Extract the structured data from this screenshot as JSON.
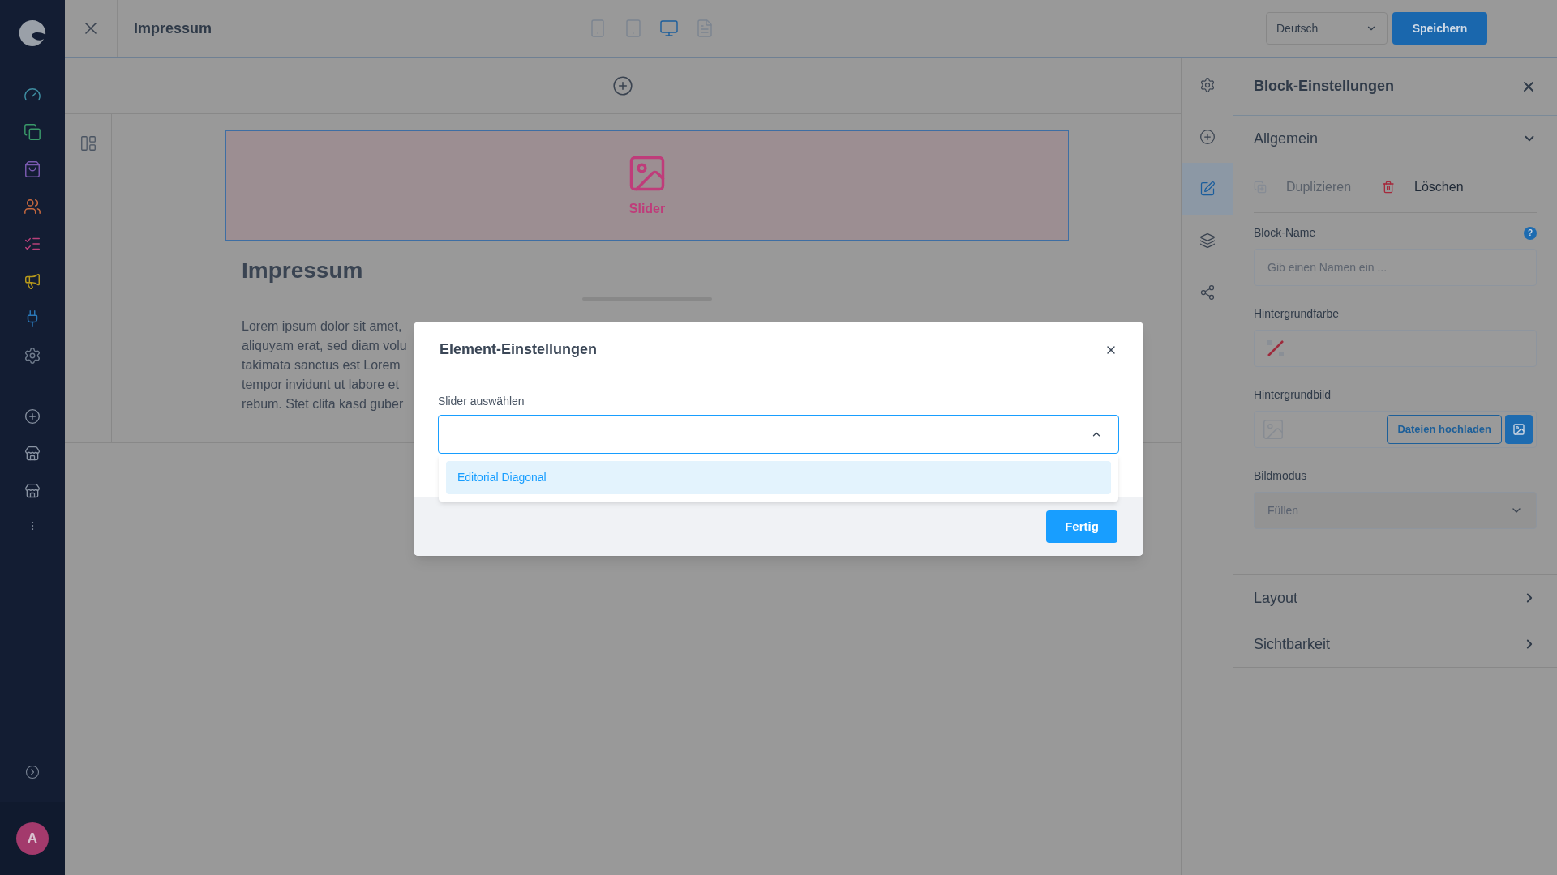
{
  "sidebar": {
    "items": [
      {
        "kind": "gauge",
        "color": "#3f8fa3"
      },
      {
        "kind": "copy",
        "color": "#3a9a6a"
      },
      {
        "kind": "bag",
        "color": "#7a5ab0"
      },
      {
        "kind": "users",
        "color": "#c8693f"
      },
      {
        "kind": "list",
        "color": "#b8407a"
      },
      {
        "kind": "megaphone",
        "color": "#b89a1c"
      },
      {
        "kind": "plug",
        "color": "#2a78b8"
      },
      {
        "kind": "gear",
        "color": "#6f7b8c"
      }
    ],
    "lower_items": [
      {
        "kind": "plus"
      },
      {
        "kind": "store"
      },
      {
        "kind": "store"
      },
      {
        "kind": "more"
      }
    ],
    "avatar": "A"
  },
  "topbar": {
    "title": "Impressum",
    "devices": [
      {
        "kind": "mobile",
        "selected": false
      },
      {
        "kind": "tablet",
        "selected": false
      },
      {
        "kind": "desktop",
        "selected": true
      },
      {
        "kind": "list",
        "selected": false
      }
    ],
    "language": "Deutsch",
    "save": "Speichern"
  },
  "canvas": {
    "slider_block": {
      "label": "Slider"
    },
    "heading": "Impressum",
    "paragraph_lines": [
      "Lorem ipsum dolor sit amet,",
      "aliquyam erat, sed diam volu",
      "takimata sanctus est Lorem",
      "tempor invidunt ut labore et",
      "rebum. Stet clita kasd guber"
    ]
  },
  "tool_strip": [
    {
      "kind": "gear",
      "selected": false
    },
    {
      "kind": "plus",
      "selected": false
    },
    {
      "kind": "edit",
      "selected": true
    },
    {
      "kind": "layers",
      "selected": false
    },
    {
      "kind": "share",
      "selected": false
    }
  ],
  "panel": {
    "title": "Block-Einstellungen",
    "sections": [
      {
        "title": "Allgemein",
        "expanded": true,
        "actions": [
          {
            "label": "Duplizieren",
            "disabled": true,
            "kind": "duplicate"
          },
          {
            "label": "Löschen",
            "disabled": false,
            "kind": "delete"
          }
        ],
        "fields": [
          {
            "kind": "text",
            "label": "Block-Name",
            "help": "?",
            "placeholder": "Gib einen Namen ein ..."
          },
          {
            "kind": "color",
            "label": "Hintergrundfarbe"
          },
          {
            "kind": "image",
            "label": "Hintergrundbild",
            "button": "Dateien hochladen"
          },
          {
            "kind": "select",
            "label": "Bildmodus",
            "value": "Füllen"
          }
        ]
      },
      {
        "title": "Layout",
        "expanded": false
      },
      {
        "title": "Sichtbarkeit",
        "expanded": false
      }
    ]
  },
  "modal": {
    "title": "Element-Einstellungen",
    "field_label": "Slider auswählen",
    "expanded": true,
    "options": [
      {
        "label": "Editorial Diagonal",
        "selected": true
      }
    ],
    "done": "Fertig"
  }
}
